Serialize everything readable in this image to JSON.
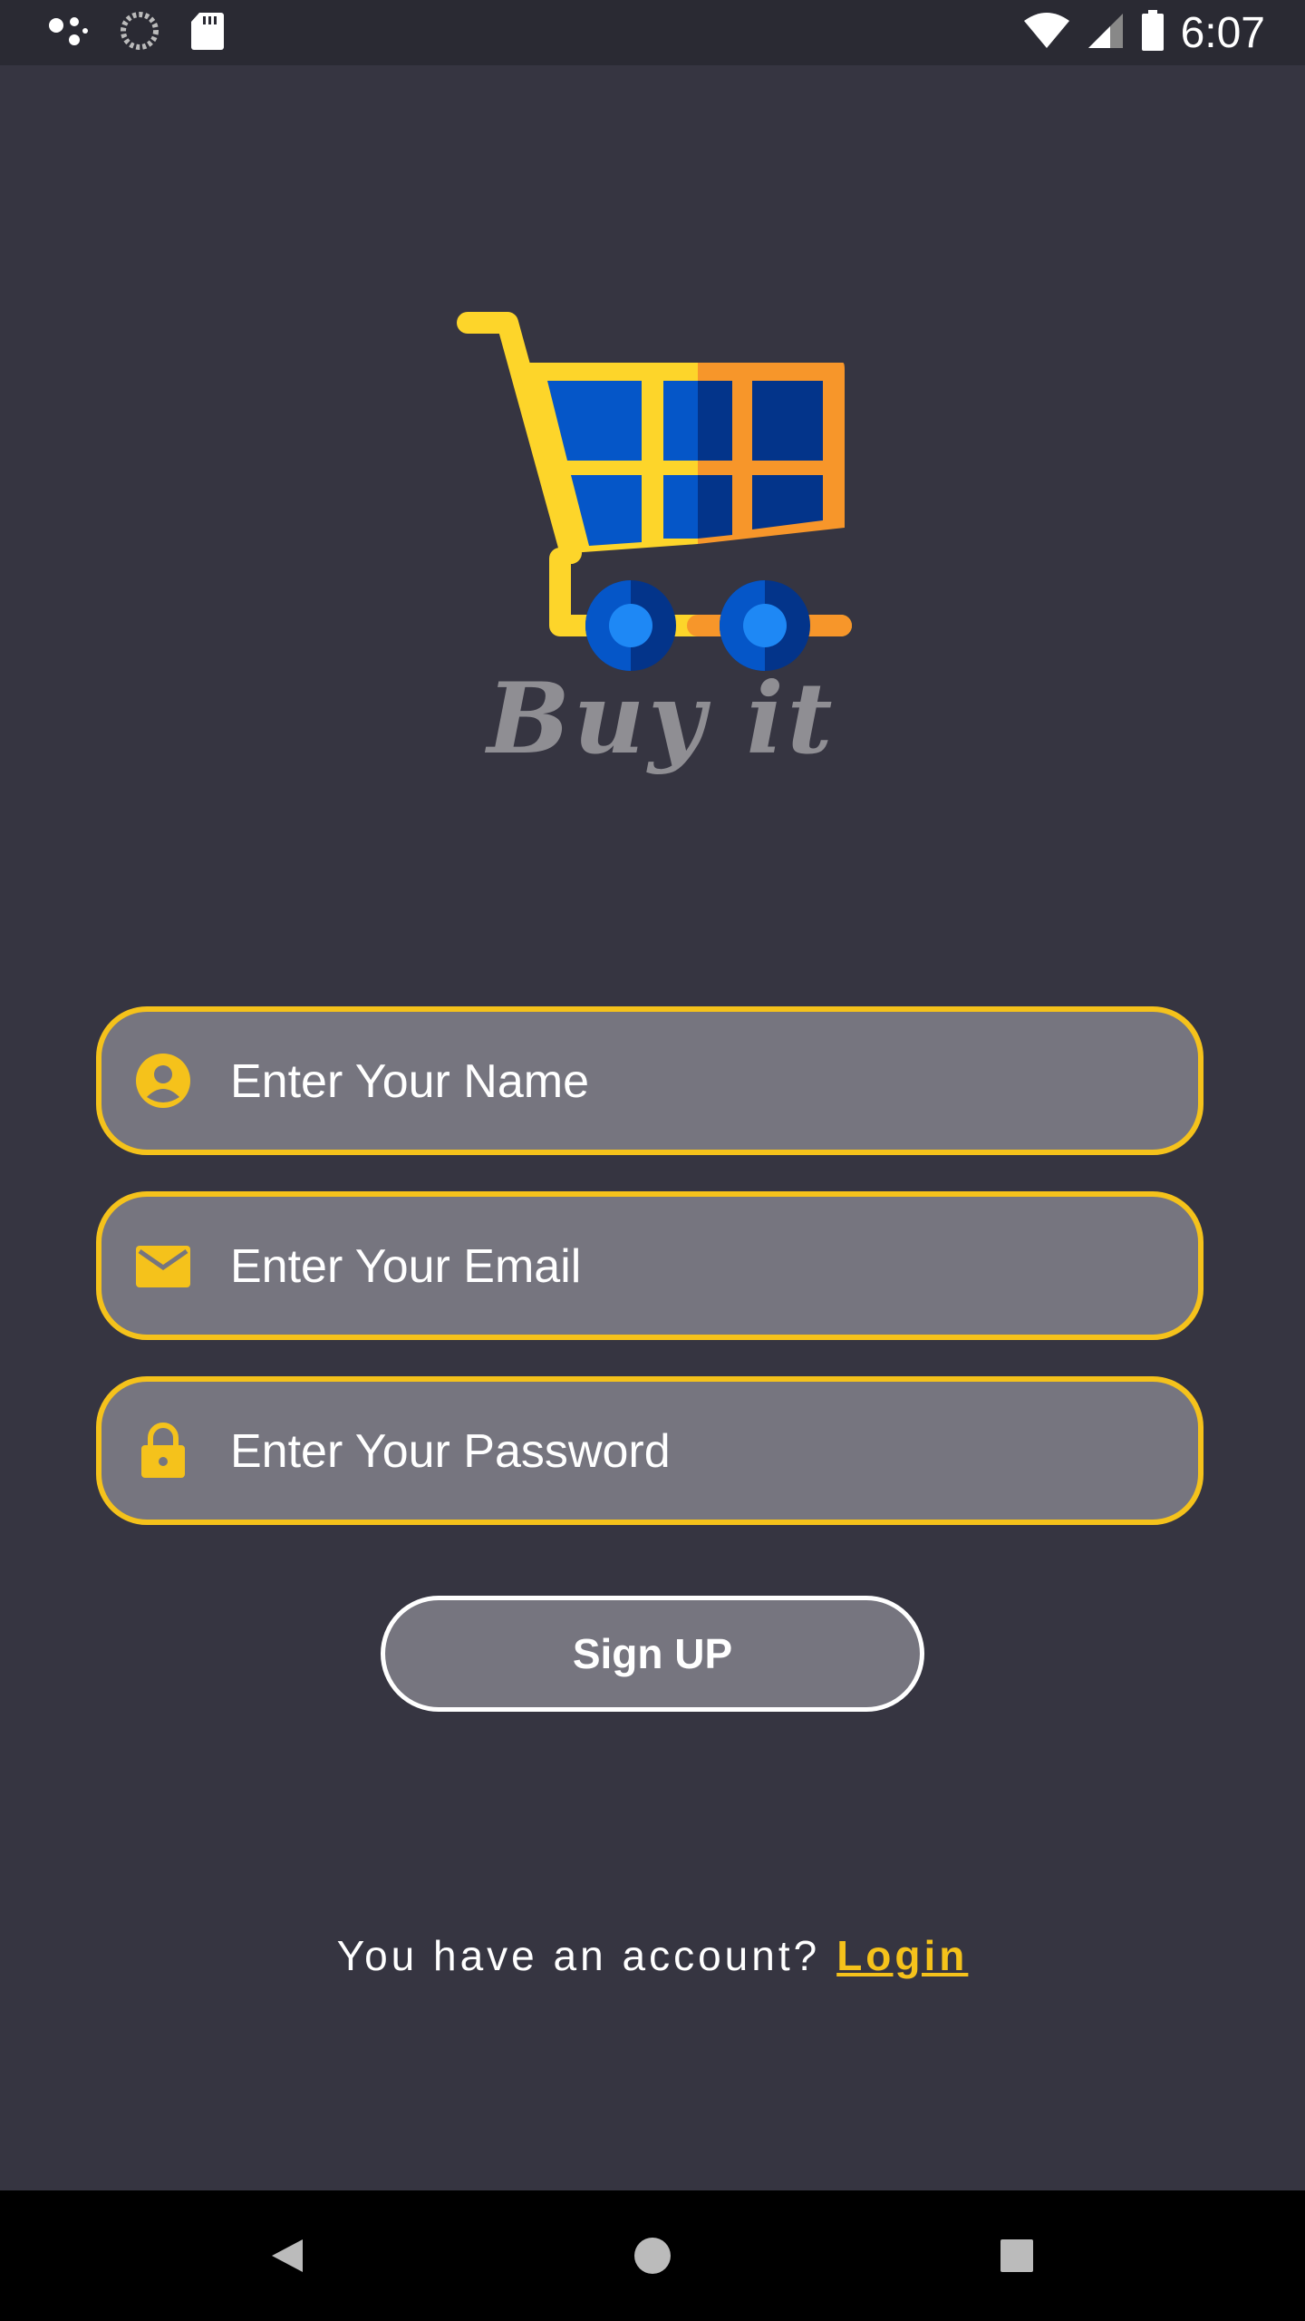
{
  "status_bar": {
    "time": "6:07",
    "left_icons": [
      "assistant-dots-icon",
      "sync-spinner-icon",
      "sd-card-icon"
    ],
    "right_icons": [
      "wifi-icon",
      "cell-signal-icon",
      "battery-icon"
    ]
  },
  "brand": {
    "name": "Buy it",
    "logo": "shopping-cart-logo"
  },
  "form": {
    "name_field": {
      "placeholder": "Enter Your Name",
      "icon": "account-circle-icon"
    },
    "email_field": {
      "placeholder": "Enter Your Email",
      "icon": "mail-icon"
    },
    "password_field": {
      "placeholder": "Enter Your Password",
      "icon": "lock-icon"
    },
    "signup_label": "Sign UP"
  },
  "footer": {
    "account_prompt": "You have an account?",
    "login_label": "Login"
  },
  "nav_bar": {
    "buttons": [
      "back-icon",
      "home-icon",
      "recents-icon"
    ]
  },
  "colors": {
    "background": "#363541",
    "accent": "#f5c21b",
    "field_fill": "#76757f"
  }
}
